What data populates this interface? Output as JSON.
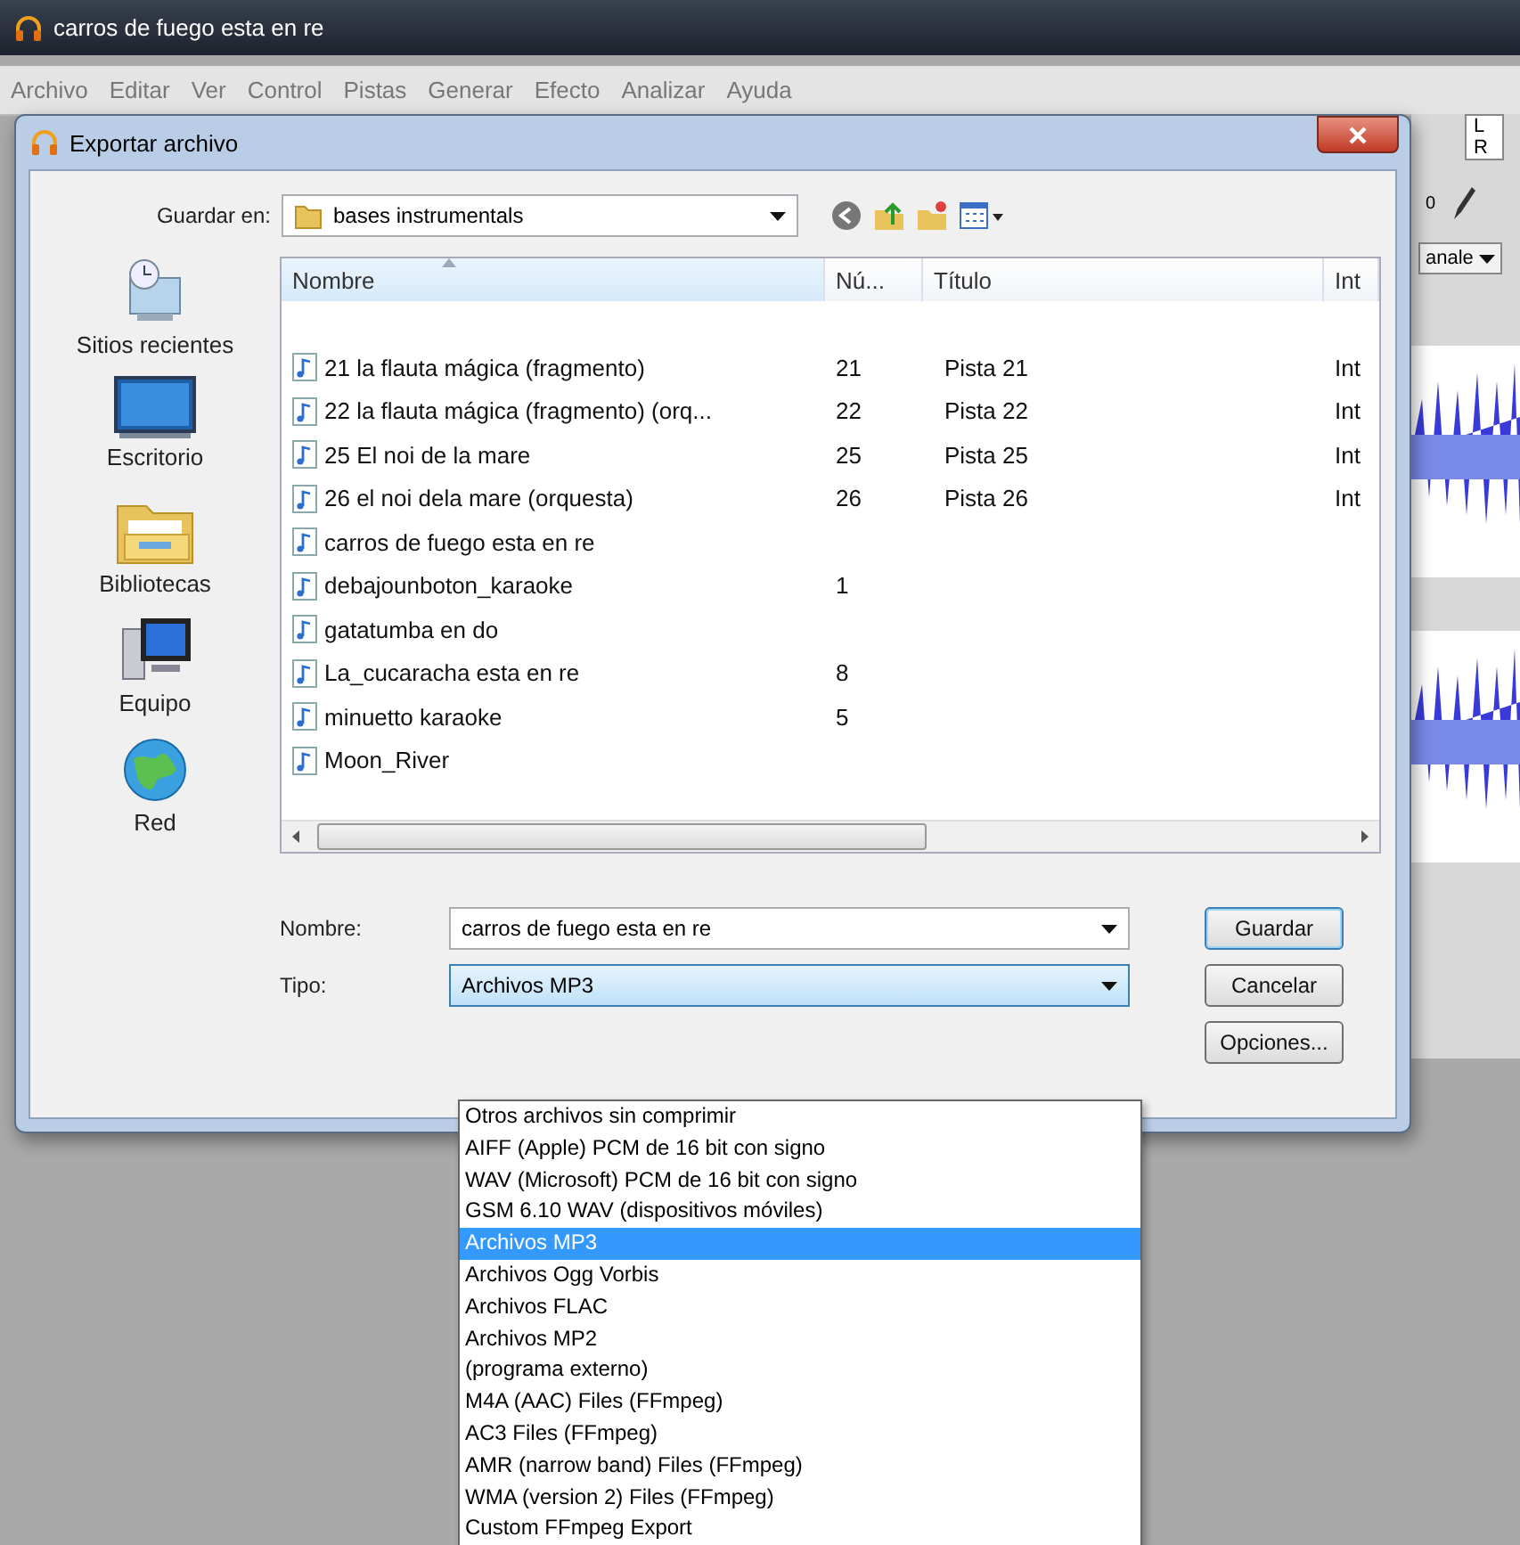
{
  "app": {
    "title": "carros de fuego esta en re",
    "menu": [
      "Archivo",
      "Editar",
      "Ver",
      "Control",
      "Pistas",
      "Generar",
      "Efecto",
      "Analizar",
      "Ayuda"
    ],
    "meter_labels": [
      "L",
      "R"
    ],
    "meter_reading": "0",
    "channel_select": "anale"
  },
  "dialog": {
    "title": "Exportar archivo",
    "save_in_label": "Guardar en:",
    "save_in": "bases instrumentals",
    "places": [
      {
        "label": "Sitios recientes",
        "kind": "recent"
      },
      {
        "label": "Escritorio",
        "kind": "desktop"
      },
      {
        "label": "Bibliotecas",
        "kind": "libraries"
      },
      {
        "label": "Equipo",
        "kind": "computer"
      },
      {
        "label": "Red",
        "kind": "network"
      }
    ],
    "columns": [
      "Nombre",
      "Nú...",
      "Título",
      "Int"
    ],
    "files": [
      {
        "name": "21 la flauta mágica (fragmento)",
        "number": "21",
        "title": "Pista 21",
        "column_4": "Int"
      },
      {
        "name": "22 la flauta mágica (fragmento) (orq...",
        "number": "22",
        "title": "Pista 22",
        "column_4": "Int"
      },
      {
        "name": "25 El noi de la mare",
        "number": "25",
        "title": "Pista 25",
        "column_4": "Int"
      },
      {
        "name": "26 el noi dela mare (orquesta)",
        "number": "26",
        "title": "Pista 26",
        "column_4": "Int"
      },
      {
        "name": "carros de fuego esta en re"
      },
      {
        "name": "debajounboton_karaoke",
        "number": "1"
      },
      {
        "name": "gatatumba en do"
      },
      {
        "name": "La_cucaracha esta en re",
        "number": "8"
      },
      {
        "name": "minuetto karaoke",
        "number": "5"
      },
      {
        "name": "Moon_River"
      }
    ],
    "name_label": "Nombre:",
    "name_value": "carros de fuego esta en re",
    "type_label": "Tipo:",
    "type_value": "Archivos MP3",
    "buttons": [
      "Guardar",
      "Cancelar",
      "Opciones..."
    ],
    "type_options": [
      {
        "label": "Otros archivos sin comprimir",
        "selected": false
      },
      {
        "label": "AIFF (Apple) PCM de 16 bit con signo",
        "selected": false
      },
      {
        "label": "WAV (Microsoft) PCM de 16 bit con signo",
        "selected": false
      },
      {
        "label": "GSM 6.10 WAV (dispositivos móviles)",
        "selected": false
      },
      {
        "label": "Archivos MP3",
        "selected": true
      },
      {
        "label": "Archivos Ogg Vorbis",
        "selected": false
      },
      {
        "label": "Archivos FLAC",
        "selected": false
      },
      {
        "label": "Archivos MP2",
        "selected": false
      },
      {
        "label": "(programa externo)",
        "selected": false
      },
      {
        "label": "M4A (AAC) Files (FFmpeg)",
        "selected": false
      },
      {
        "label": "AC3 Files (FFmpeg)",
        "selected": false
      },
      {
        "label": "AMR (narrow band) Files (FFmpeg)",
        "selected": false
      },
      {
        "label": "WMA (version 2) Files (FFmpeg)",
        "selected": false
      },
      {
        "label": "Custom FFmpeg Export",
        "selected": false
      }
    ]
  }
}
